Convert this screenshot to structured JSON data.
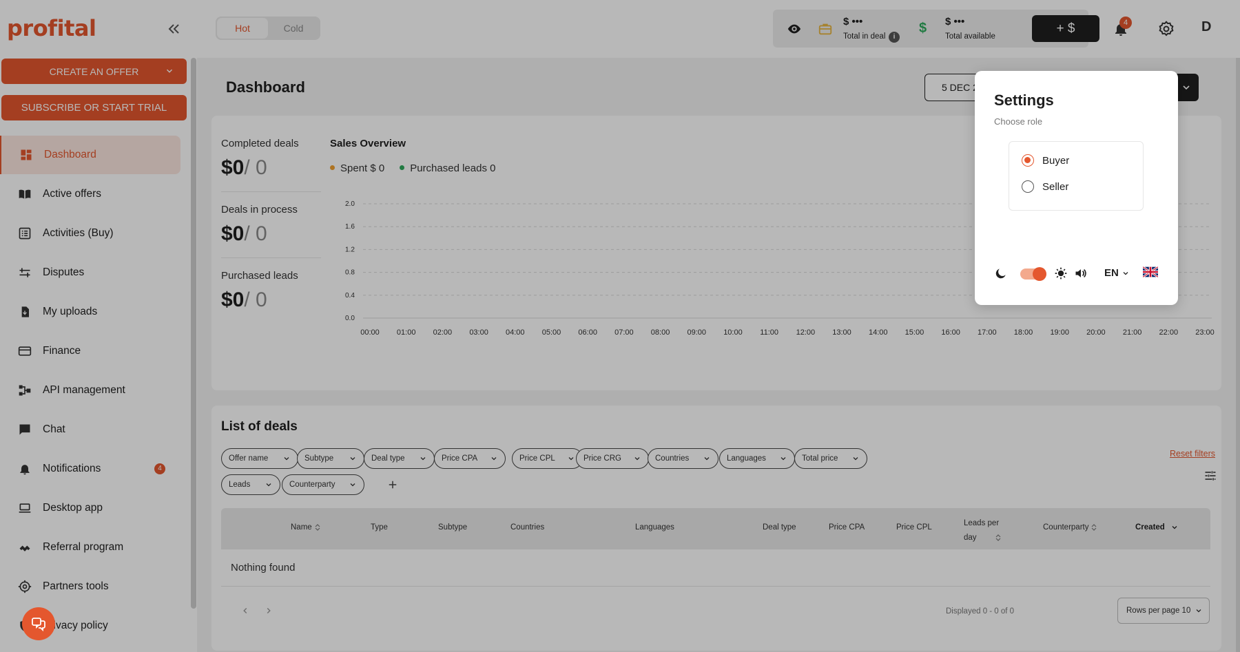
{
  "app": {
    "logo": "profital"
  },
  "topbar": {
    "toggle": {
      "hot": "Hot",
      "cold": "Cold",
      "active": "hot"
    },
    "balance": {
      "in_deal_amount": "$ •••",
      "in_deal_label": "Total in deal",
      "available_amount": "$ •••",
      "available_label": "Total available"
    },
    "add_funds_label": "+ $",
    "notifications_count": "4",
    "avatar_initial": "D"
  },
  "sidebar": {
    "create_offer": "CREATE AN OFFER",
    "subscribe": "SUBSCRIBE OR START TRIAL",
    "items": [
      {
        "label": "Dashboard",
        "icon": "dashboard-icon",
        "active": true
      },
      {
        "label": "Active offers",
        "icon": "book-icon"
      },
      {
        "label": "Activities (Buy)",
        "icon": "list-icon"
      },
      {
        "label": "Disputes",
        "icon": "disputes-icon"
      },
      {
        "label": "My uploads",
        "icon": "upload-icon"
      },
      {
        "label": "Finance",
        "icon": "card-icon"
      },
      {
        "label": "API management",
        "icon": "api-icon"
      },
      {
        "label": "Chat",
        "icon": "chat-icon"
      },
      {
        "label": "Notifications",
        "icon": "bell-icon",
        "badge": "4"
      },
      {
        "label": "Desktop app",
        "icon": "laptop-icon"
      },
      {
        "label": "Referral program",
        "icon": "referral-icon"
      },
      {
        "label": "Partners tools",
        "icon": "target-icon"
      },
      {
        "label": "Privacy policy",
        "icon": "shield-icon"
      }
    ]
  },
  "main": {
    "title": "Dashboard",
    "date_range": "5 DEC 2",
    "stats": [
      {
        "label": "Completed deals",
        "amount": "$0",
        "count": "/ 0"
      },
      {
        "label": "Deals in process",
        "amount": "$0",
        "count": "/ 0"
      },
      {
        "label": "Purchased leads",
        "amount": "$0",
        "count": "/ 0"
      }
    ],
    "sales_overview": {
      "title": "Sales Overview",
      "legend_spent": "Spent $ 0",
      "legend_leads": "Purchased leads 0"
    },
    "deals": {
      "title": "List of deals",
      "filters": [
        "Offer name",
        "Subtype",
        "Deal type",
        "Price CPA",
        "Price CPL",
        "Price CRG",
        "Countries",
        "Languages",
        "Total price",
        "Leads",
        "Counterparty"
      ],
      "reset_filters": "Reset filters",
      "columns": [
        "Name",
        "Type",
        "Subtype",
        "Countries",
        "Languages",
        "Deal type",
        "Price CPA",
        "Price CPL",
        "Leads per",
        "day",
        "Counterparty",
        "Created"
      ],
      "empty_text": "Nothing found",
      "displayed": "Displayed 0 - 0 of 0",
      "rows_per_page": "Rows per page 10"
    }
  },
  "settings": {
    "title": "Settings",
    "subtitle": "Choose role",
    "roles": [
      {
        "label": "Buyer",
        "selected": true
      },
      {
        "label": "Seller",
        "selected": false
      }
    ],
    "language": "EN"
  },
  "colors": {
    "accent": "#e4572e",
    "spent_dot": "#f0a030",
    "leads_dot": "#2eaa5c",
    "grid": "#d9d9d9"
  },
  "chart_data": {
    "type": "line",
    "x": [
      "00:00",
      "01:00",
      "02:00",
      "03:00",
      "04:00",
      "05:00",
      "06:00",
      "07:00",
      "08:00",
      "09:00",
      "10:00",
      "11:00",
      "12:00",
      "13:00",
      "14:00",
      "15:00",
      "16:00",
      "17:00",
      "18:00",
      "19:00",
      "20:00",
      "21:00",
      "22:00",
      "23:00"
    ],
    "yticks": [
      "0.0",
      "0.4",
      "0.8",
      "1.2",
      "1.6",
      "2.0"
    ],
    "ylim": [
      0,
      2.0
    ],
    "series": [
      {
        "name": "Spent",
        "values": [
          0,
          0,
          0,
          0,
          0,
          0,
          0,
          0,
          0,
          0,
          0,
          0,
          0,
          0,
          0,
          0,
          0,
          0,
          0,
          0,
          0,
          0,
          0,
          0
        ]
      },
      {
        "name": "Purchased leads",
        "values": [
          0,
          0,
          0,
          0,
          0,
          0,
          0,
          0,
          0,
          0,
          0,
          0,
          0,
          0,
          0,
          0,
          0,
          0,
          0,
          0,
          0,
          0,
          0,
          0
        ]
      }
    ],
    "grid": true
  }
}
